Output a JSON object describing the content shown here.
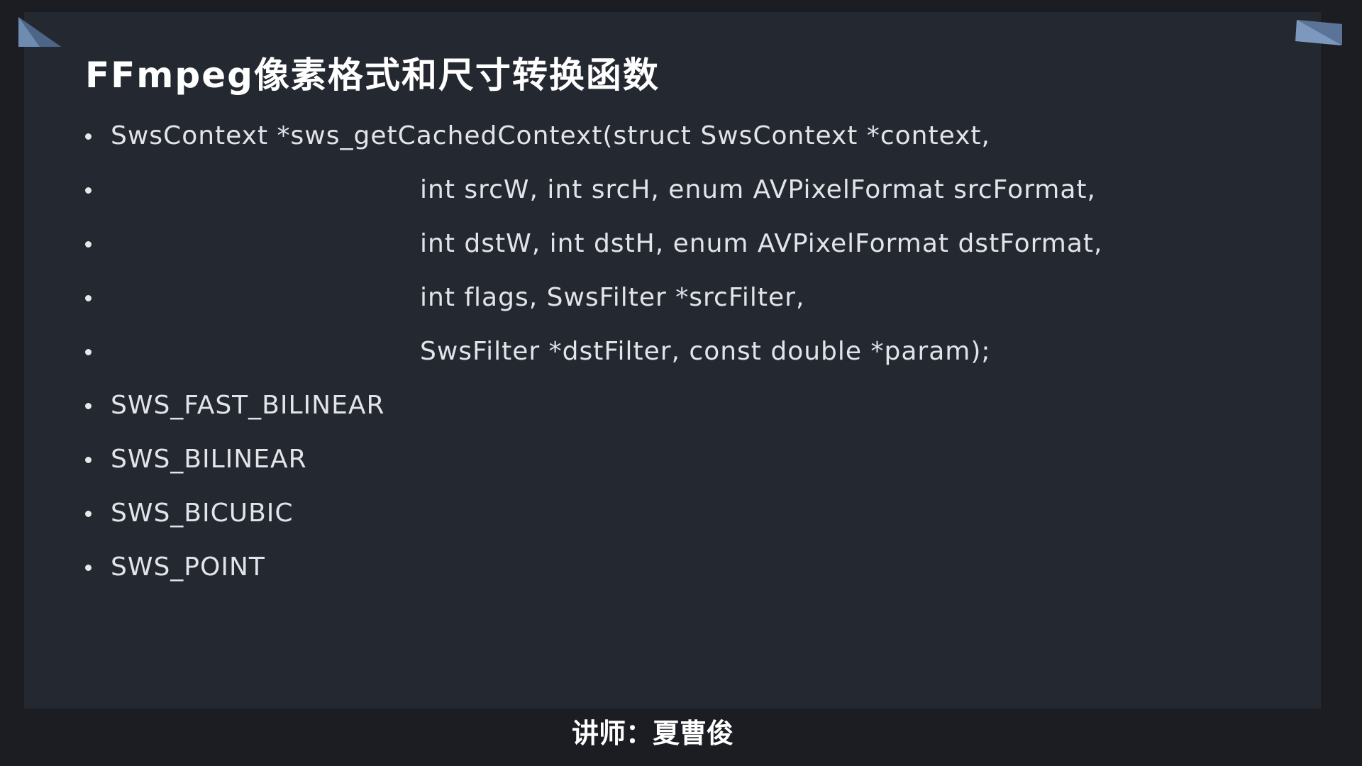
{
  "slide": {
    "title": "FFmpeg像素格式和尺寸转换函数",
    "bullets": [
      {
        "text": "SwsContext *sws_getCachedContext(struct SwsContext *context,"
      },
      {
        "text": "int srcW, int srcH, enum AVPixelFormat srcFormat,"
      },
      {
        "text": "int dstW, int dstH, enum AVPixelFormat dstFormat,"
      },
      {
        "text": "int flags, SwsFilter *srcFilter,"
      },
      {
        "text": "SwsFilter *dstFilter, const double *param);"
      },
      {
        "text": "SWS_FAST_BILINEAR"
      },
      {
        "text": "SWS_BILINEAR"
      },
      {
        "text": "SWS_BICUBIC"
      },
      {
        "text": "SWS_POINT"
      }
    ]
  },
  "footer": {
    "caption": "讲师：夏曹俊"
  },
  "colors": {
    "frame_background": "#1b1d22",
    "slide_background": "#242830",
    "corner_accent": "#6e8bb0",
    "text": "#e2e4e8",
    "title": "#ffffff"
  }
}
